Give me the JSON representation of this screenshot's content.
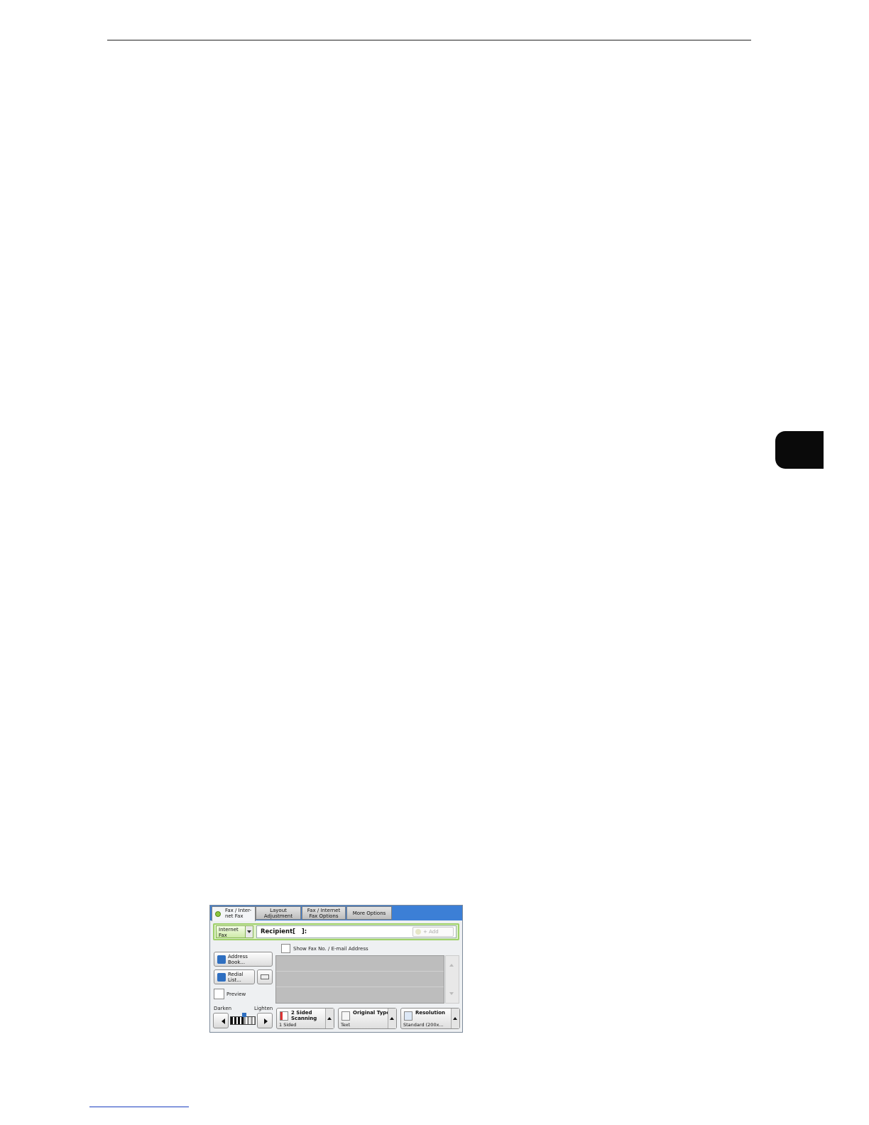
{
  "panel": {
    "tabs": [
      {
        "label": "Fax / Inter-\nnet Fax"
      },
      {
        "label": "Layout\nAdjustment"
      },
      {
        "label": "Fax / Internet\nFax Options"
      },
      {
        "label": "More Options"
      }
    ],
    "mode_select": "Internet\nFax",
    "recipient_label": "Recipient[   ]:",
    "add_label": "+ Add",
    "show_address_label": "Show Fax No. / E-mail Address",
    "address_book_label": "Address\nBook...",
    "redial_label": "Redial\nList...",
    "preview_label": "Preview",
    "density": {
      "darken_label": "Darken",
      "lighten_label": "Lighten"
    },
    "features": [
      {
        "title": "2 Sided\nScanning",
        "value": "1 Sided"
      },
      {
        "title": "Original Type",
        "value": "Text"
      },
      {
        "title": "Resolution",
        "value": "Standard (200x..."
      }
    ]
  },
  "icons": [
    "fax-tab-icon",
    "address-book-icon",
    "redial-icon",
    "keyboard-icon",
    "scan-icon",
    "original-type-icon",
    "resolution-icon"
  ]
}
